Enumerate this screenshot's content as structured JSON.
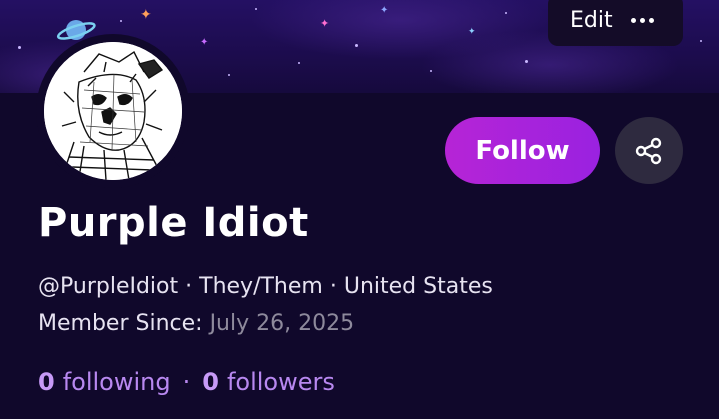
{
  "banner": {
    "edit_label": "Edit",
    "more_icon": "more-horizontal-icon"
  },
  "profile": {
    "display_name": "Purple Idiot",
    "handle": "@PurpleIdiot",
    "pronouns": "They/Them",
    "location": "United States",
    "separator": "·",
    "member_since_label": "Member Since:",
    "member_since_date": "July 26, 2025"
  },
  "actions": {
    "follow_label": "Follow",
    "share_icon": "share-icon"
  },
  "stats": {
    "following_count": "0",
    "following_label": "following",
    "followers_count": "0",
    "followers_label": "followers",
    "separator": "·"
  },
  "colors": {
    "background": "#10082b",
    "accent": "#a824dc",
    "link": "#b888f0"
  }
}
